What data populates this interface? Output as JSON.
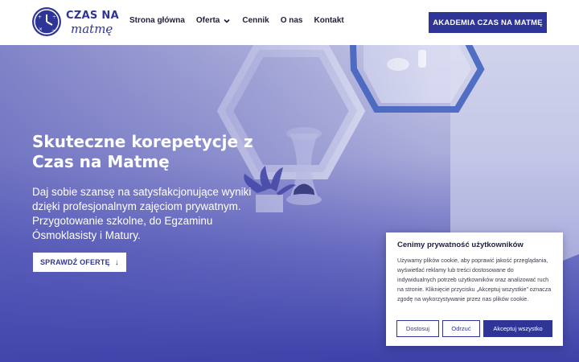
{
  "logo": {
    "line1": "CZAS NA",
    "line2": "matmę"
  },
  "nav": {
    "items": [
      {
        "label": "Strona główna"
      },
      {
        "label": "Oferta"
      },
      {
        "label": "Cennik"
      },
      {
        "label": "O nas"
      },
      {
        "label": "Kontakt"
      }
    ],
    "cta": "AKADEMIA CZAS NA MATMĘ"
  },
  "hero": {
    "title": "Skuteczne korepetycje z Czas na Matmę",
    "subtitle": "Daj sobie szansę na satysfakcjonujące wyniki dzięki profesjonalnym zajęciom prywatnym. Przygotowanie szkolne, do Egzaminu Ósmoklasisty i Matury.",
    "button": "SPRAWDŹ OFERTĘ",
    "button_icon": "arrow-down-icon"
  },
  "cookie": {
    "title": "Cenimy prywatność użytkowników",
    "text": "Używamy plików cookie, aby poprawić jakość przeglądania, wyświetlać reklamy lub treści dostosowane do indywidualnych potrzeb użytkowników oraz analizować ruch na stronie. Kliknięcie przycisku „Akceptuj wszystkie” oznacza zgodę na wykorzystywanie przez nas plików cookie.",
    "customize": "Dostosuj",
    "reject": "Odrzuć",
    "accept": "Akceptuj wszystko"
  },
  "colors": {
    "brand": "#2e3596",
    "text_dark": "#1e1f3d",
    "white": "#ffffff"
  }
}
